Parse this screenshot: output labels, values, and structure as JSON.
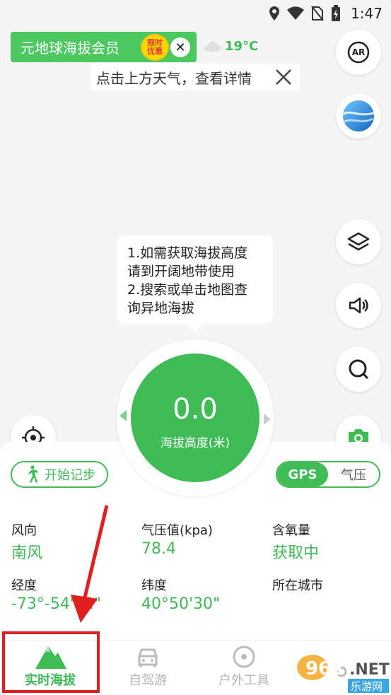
{
  "status_bar": {
    "time": "1:47"
  },
  "member_banner": {
    "text": "元地球海拔会员",
    "badge_line1": "限时",
    "badge_line2": "优惠"
  },
  "weather": {
    "temp": "19°C",
    "tip": "点击上方天气，查看详情"
  },
  "fabs": {
    "ar_label": "AR"
  },
  "tooltip": {
    "lines": [
      "1.如需获取海拔高度",
      "请到开阔地带使用",
      "2.搜索或单击地图查",
      "询异地海拔"
    ]
  },
  "dial": {
    "value": "0.0",
    "label": "海拔高度(米)"
  },
  "controls": {
    "record_label": "开始记步",
    "mode_options": [
      "GPS",
      "气压"
    ],
    "mode_selected": "GPS"
  },
  "info": {
    "wind_label": "风向",
    "wind_value": "南风",
    "pressure_label": "气压值(kpa)",
    "pressure_value": "78.4",
    "oxygen_label": "含氧量",
    "oxygen_value": "获取中",
    "lon_label": "经度",
    "lon_value": "-73°-54'22\"",
    "lat_label": "纬度",
    "lat_value": "40°50'30\"",
    "city_label": "所在城市"
  },
  "tabs": [
    {
      "label": "实时海拔",
      "active": true
    },
    {
      "label": "自驾游",
      "active": false
    },
    {
      "label": "户外工具",
      "active": false
    },
    {
      "label": "",
      "active": false
    }
  ],
  "watermark": {
    "brand": "962",
    "net": ".NET",
    "site": "乐游网"
  },
  "colors": {
    "accent": "#3fbc55",
    "highlight": "#e02020",
    "badge": "#ffd600"
  }
}
